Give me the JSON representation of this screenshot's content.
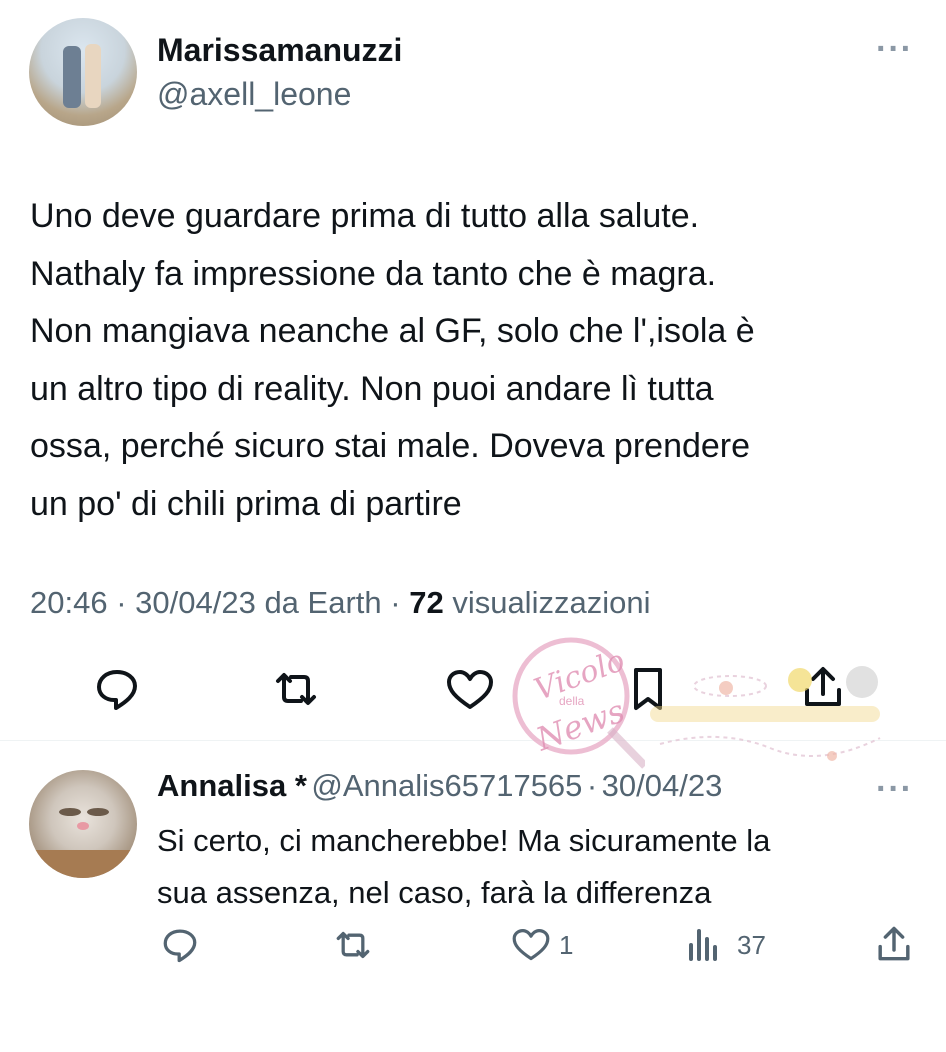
{
  "tweet": {
    "author_name": "Marissamanuzzi",
    "author_handle": "@axell_leone",
    "text": "Uno deve guardare prima di tutto alla salute.\nNathaly fa impressione da tanto che è magra.\nNon mangiava neanche al GF, solo che l',isola è\nun altro tipo di reality. Non puoi andare lì tutta\nossa, perché sicuro  stai male. Doveva prendere\nun po' di chili prima di partire",
    "time": "20:46",
    "date": "30/04/23",
    "source": "da Earth",
    "views_count": "72",
    "views_label": "visualizzazioni",
    "actions": [
      "reply-icon",
      "retweet-icon",
      "like-icon",
      "bookmark-icon",
      "share-icon"
    ]
  },
  "reply": {
    "author_name": "Annalisa *",
    "author_handle": "@Annalis65717565",
    "date": "30/04/23",
    "text": "Si certo, ci mancherebbe! Ma sicuramente la\nsua assenza, nel caso, farà  la differenza",
    "like_count": "1",
    "views_count": "37"
  },
  "watermark": {
    "line1": "Vicolo",
    "line2": "della",
    "line3": "News"
  },
  "colors": {
    "text_primary": "#0f1419",
    "text_secondary": "#536471",
    "icon_gray": "#536471",
    "divider": "#eff3f4",
    "watermark_pink": "#e7a8c4"
  }
}
